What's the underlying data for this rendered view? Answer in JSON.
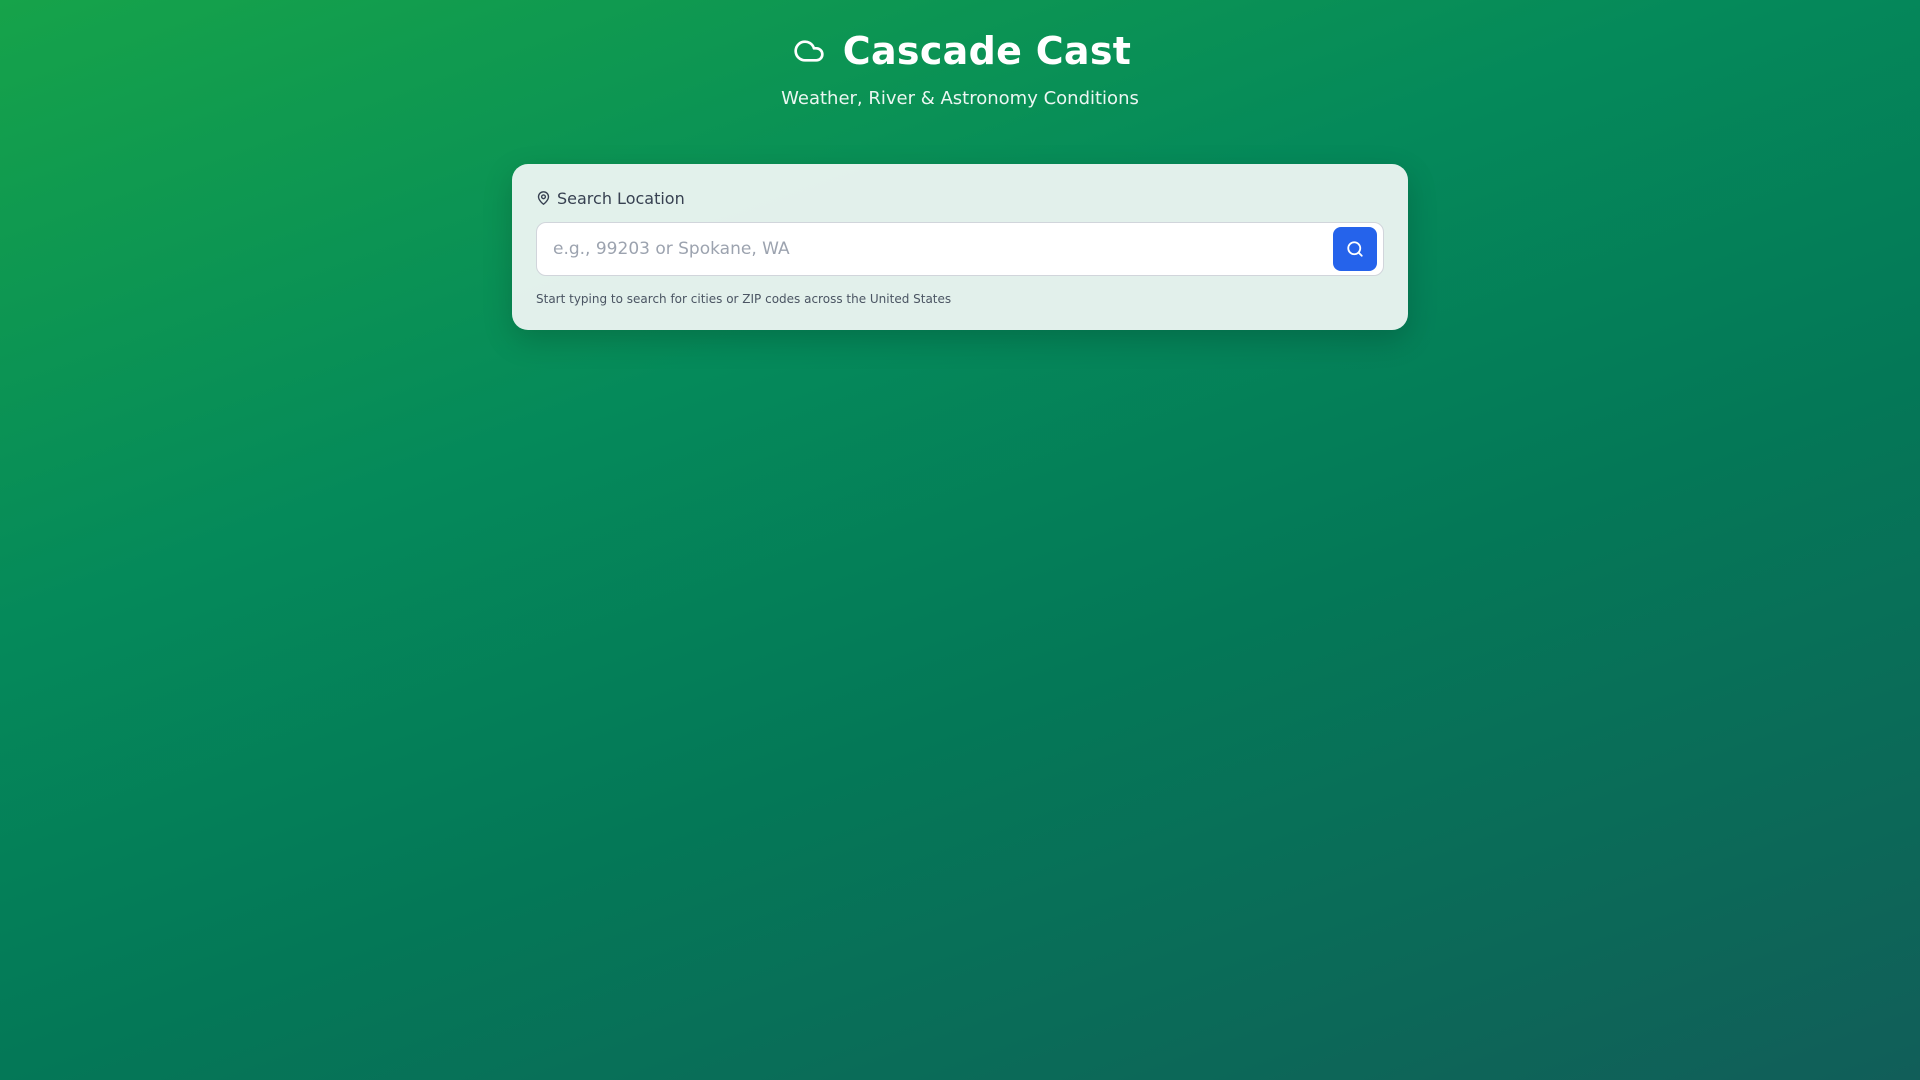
{
  "header": {
    "title": "Cascade Cast",
    "subtitle": "Weather, River & Astronomy Conditions",
    "logo_icon": "cloud-icon"
  },
  "search": {
    "label": "Search Location",
    "label_icon": "map-pin-icon",
    "input_value": "",
    "placeholder": "e.g., 99203 or Spokane, WA",
    "button_icon": "search-icon",
    "helper_text": "Start typing to search for cities or ZIP codes across the United States"
  },
  "colors": {
    "background_start": "#16a34a",
    "background_end": "#115e59",
    "button": "#2563eb",
    "card": "#f0f7f4"
  }
}
